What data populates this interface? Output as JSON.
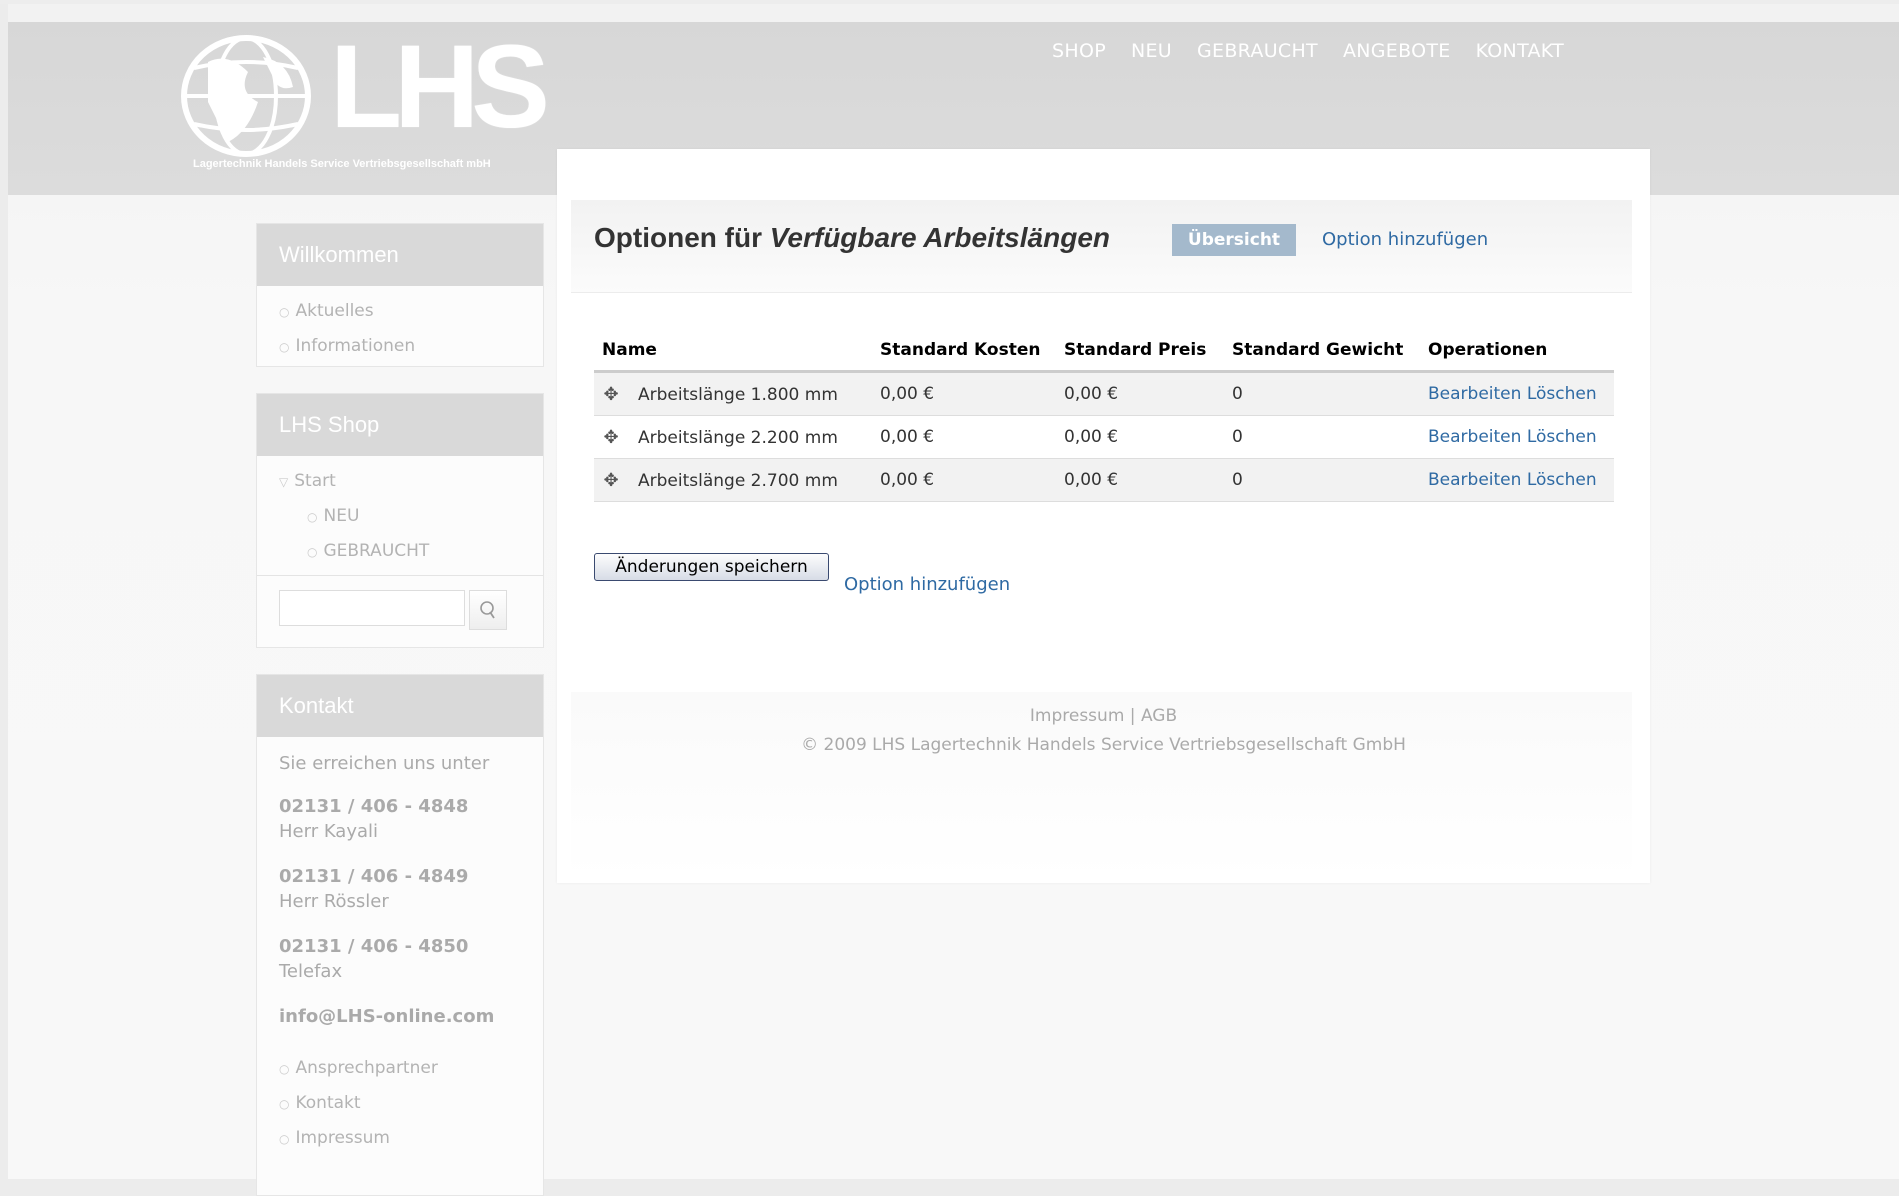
{
  "logo": {
    "text": "LHS",
    "subtitle": "Lagertechnik Handels Service Vertriebsgesellschaft mbH"
  },
  "topnav": [
    "SHOP",
    "NEU",
    "GEBRAUCHT",
    "ANGEBOTE",
    "KONTAKT"
  ],
  "sidebar": {
    "welcome": {
      "title": "Willkommen",
      "items": [
        "Aktuelles",
        "Informationen"
      ]
    },
    "shop": {
      "title": "LHS Shop",
      "start": "Start",
      "items": [
        "NEU",
        "GEBRAUCHT"
      ]
    },
    "search": {
      "placeholder": ""
    },
    "contact": {
      "title": "Kontakt",
      "intro": "Sie erreichen uns unter",
      "phones": [
        {
          "number": "02131 / 406 - 4848",
          "label": "Herr Kayali"
        },
        {
          "number": "02131 / 406 - 4849",
          "label": "Herr Rössler"
        },
        {
          "number": "02131 / 406 - 4850",
          "label": "Telefax"
        }
      ],
      "email": "info@LHS-online.com",
      "links": [
        "Ansprechpartner",
        "Kontakt",
        "Impressum"
      ]
    }
  },
  "content": {
    "title_prefix": "Optionen für ",
    "title_em": "Verfügbare Arbeitslängen",
    "tab_active": "Übersicht",
    "tab_add": "Option hinzufügen",
    "table": {
      "headers": [
        "Name",
        "Standard Kosten",
        "Standard Preis",
        "Standard Gewicht",
        "Operationen"
      ],
      "rows": [
        {
          "name": "Arbeitslänge 1.800 mm",
          "cost": "0,00 €",
          "price": "0,00 €",
          "weight": "0",
          "edit": "Bearbeiten",
          "delete": "Löschen"
        },
        {
          "name": "Arbeitslänge 2.200 mm",
          "cost": "0,00 €",
          "price": "0,00 €",
          "weight": "0",
          "edit": "Bearbeiten",
          "delete": "Löschen"
        },
        {
          "name": "Arbeitslänge 2.700 mm",
          "cost": "0,00 €",
          "price": "0,00 €",
          "weight": "0",
          "edit": "Bearbeiten",
          "delete": "Löschen"
        }
      ]
    },
    "save_button": "Änderungen speichern",
    "add_link": "Option hinzufügen"
  },
  "footer": {
    "impressum": "Impressum",
    "separator": " | ",
    "agb": "AGB",
    "copyright": "© 2009 LHS Lagertechnik Handels Service Vertriebsgesellschaft GmbH"
  },
  "colors": {
    "link": "#2f6aa3",
    "tab_active_bg": "#a4b9cc",
    "header_band": "#d7d7d7",
    "sidebar_head": "#d9d9d9"
  }
}
